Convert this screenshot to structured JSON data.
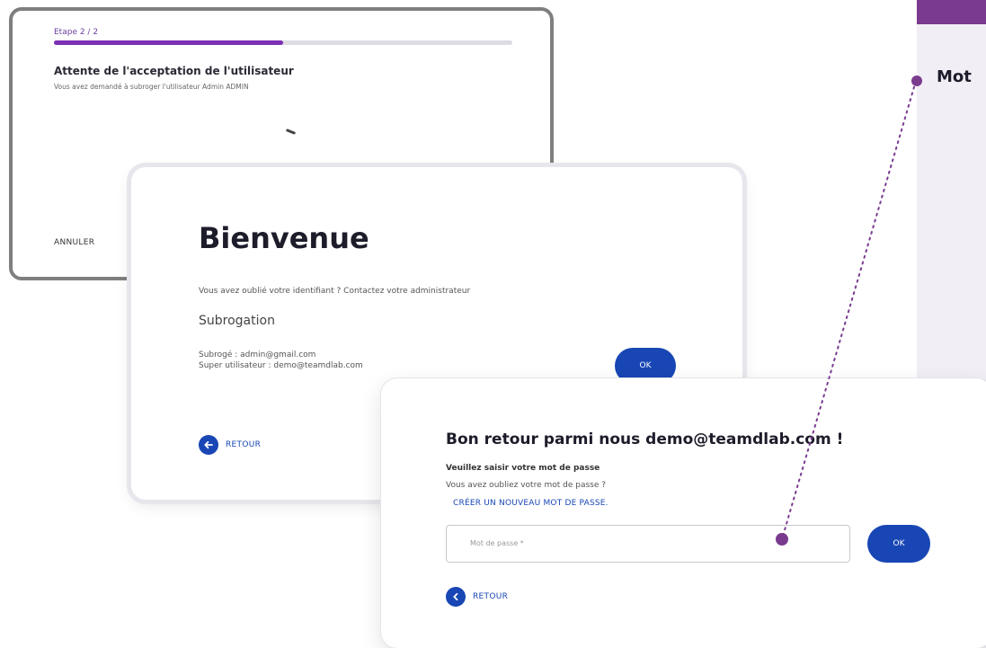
{
  "side": {
    "label": "Mot"
  },
  "waiting_card": {
    "step": "Etape 2 / 2",
    "progress": 0.5,
    "title": "Attente de l'acceptation de l'utilisateur",
    "subtitle": "Vous avez demandé à subroger l'utilisateur Admin ADMIN",
    "cancel_label": "ANNULER"
  },
  "welcome_card": {
    "heading": "Bienvenue",
    "forgot_text": "Vous avez oublié votre identifiant ? Contactez votre administrateur",
    "section_title": "Subrogation",
    "subrogated_line": "Subrogé : admin@gmail.com",
    "super_user_line": "Super utilisateur : demo@teamdlab.com",
    "ok_label": "OK",
    "back_label": "RETOUR"
  },
  "password_card": {
    "heading": "Bon retour parmi nous demo@teamdlab.com !",
    "field_label": "Veuillez saisir votre mot de passe",
    "forgot_text": "Vous avez oubliez votre mot de passe ?",
    "create_link": "CRÉER UN NOUVEAU MOT DE PASSE.",
    "password_placeholder": "Mot de passe *",
    "ok_label": "OK",
    "back_label": "RETOUR"
  },
  "colors": {
    "accent_purple": "#7a3b8f",
    "primary_blue": "#1846b4",
    "progress_purple": "#7b2fb3"
  },
  "icons": {
    "back": "arrow-left-icon",
    "back_small": "chevron-left-icon"
  }
}
